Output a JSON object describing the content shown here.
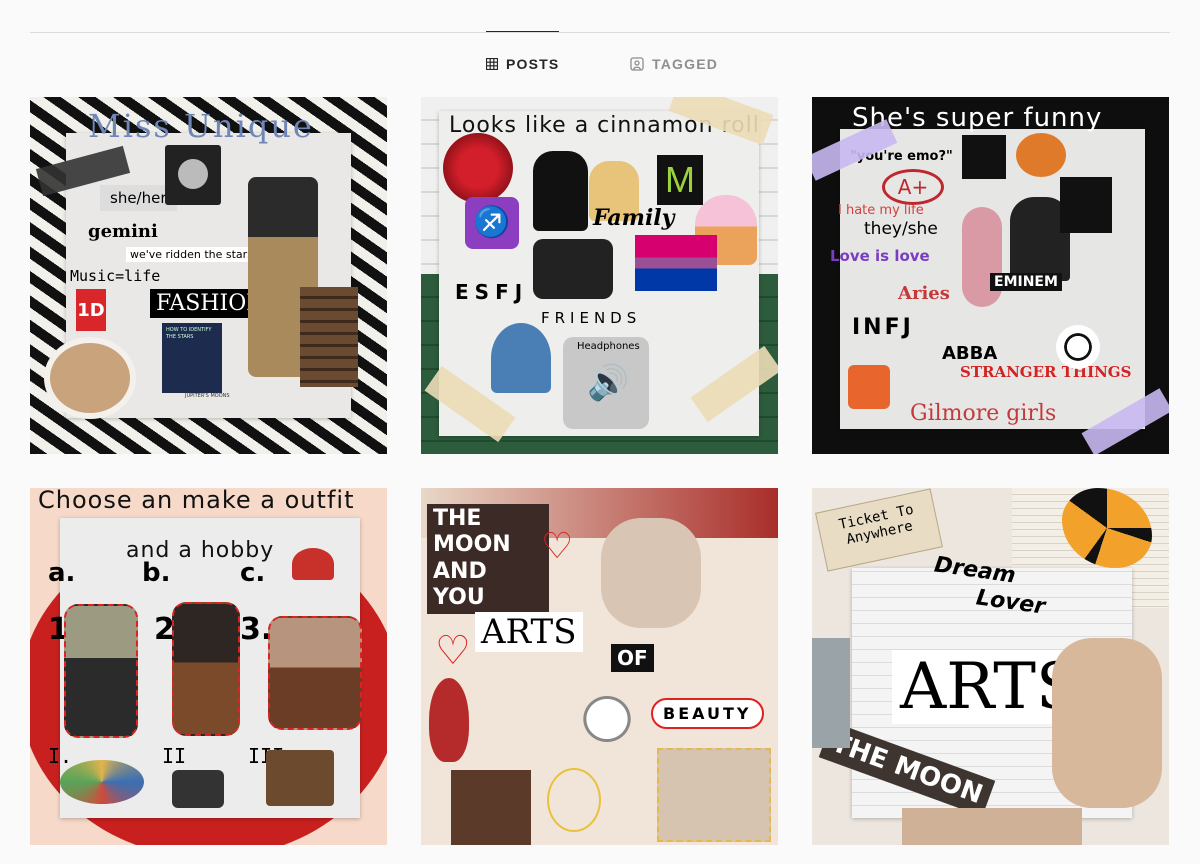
{
  "tabs": [
    {
      "label": "POSTS",
      "icon": "grid-icon",
      "active": true
    },
    {
      "label": "TAGGED",
      "icon": "tag-person-icon",
      "active": false
    }
  ],
  "posts": [
    {
      "caption": "Miss Unique",
      "stickers": [
        "she/her",
        "gemini",
        "we've ridden the stars",
        "Music=life",
        "1D",
        "FASHION",
        "HOW TO IDENTIFY THE STARS",
        "JUPITER'S MOONS"
      ]
    },
    {
      "caption": "Looks like a cinnamon roll",
      "stickers": [
        "Family",
        "ESFJ",
        "FRIENDS",
        "Headphones"
      ]
    },
    {
      "caption": "She's super funny",
      "stickers": [
        "\"you're emo?\"",
        "A+",
        "I hate my life",
        "they/she",
        "Love is love",
        "EMINEM",
        "Aries",
        "INFJ",
        "ABBA",
        "STRANGER THINGS",
        "Gilmore girls"
      ]
    },
    {
      "caption": "Choose an make a outfit",
      "subcaption": "and a hobby",
      "stickers": [
        "a.",
        "b.",
        "c.",
        "1.",
        "2.",
        "3.",
        "I.",
        "II",
        "III"
      ]
    },
    {
      "caption": "",
      "stickers": [
        "THE MOON AND YOU",
        "ARTS",
        "OF",
        "BEAUTY"
      ]
    },
    {
      "caption": "",
      "stickers": [
        "Ticket To Anywhere",
        "Dream",
        "Lover",
        "ARTS",
        "THE MOON"
      ]
    }
  ],
  "colors": {
    "active_tab": "#262626",
    "inactive_tab": "#8e8e8e",
    "divider": "#dbdbdb"
  }
}
